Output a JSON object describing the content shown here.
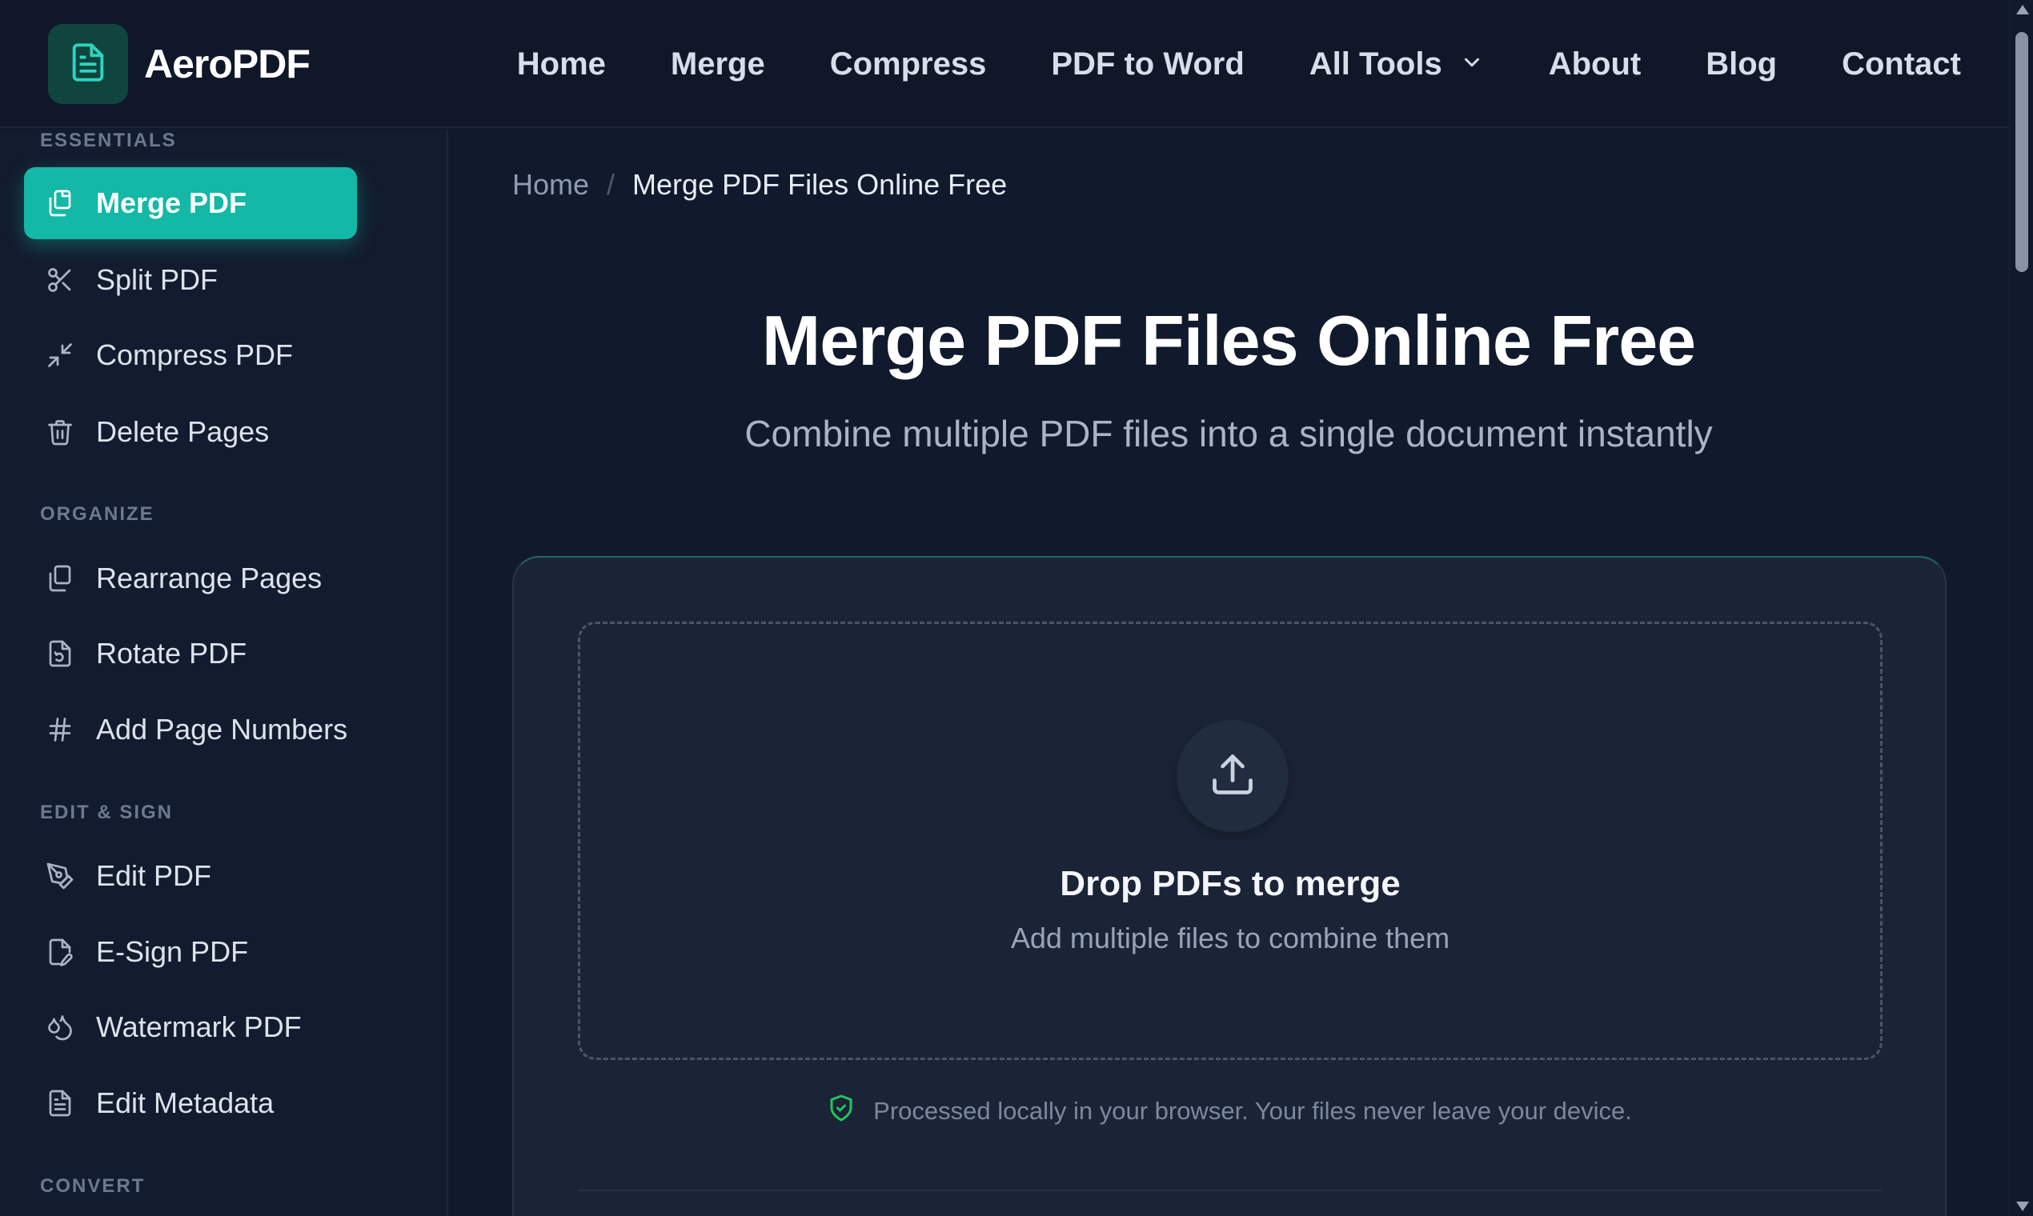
{
  "header": {
    "brand": "AeroPDF",
    "logo_icon": "document-icon",
    "nav": [
      {
        "label": "Home"
      },
      {
        "label": "Merge"
      },
      {
        "label": "Compress"
      },
      {
        "label": "PDF to Word"
      },
      {
        "label": "All Tools",
        "icon": "chevron-down-icon"
      },
      {
        "label": "About"
      },
      {
        "label": "Blog"
      },
      {
        "label": "Contact"
      }
    ]
  },
  "sidebar": {
    "sections": [
      {
        "label": "ESSENTIALS",
        "items": [
          {
            "label": "Merge PDF",
            "icon": "merge-icon",
            "active": true
          },
          {
            "label": "Split PDF",
            "icon": "scissors-icon"
          },
          {
            "label": "Compress PDF",
            "icon": "compress-icon"
          },
          {
            "label": "Delete Pages",
            "icon": "trash-icon"
          }
        ]
      },
      {
        "label": "ORGANIZE",
        "items": [
          {
            "label": "Rearrange Pages",
            "icon": "copy-icon"
          },
          {
            "label": "Rotate PDF",
            "icon": "rotate-file-icon"
          },
          {
            "label": "Add Page Numbers",
            "icon": "hash-icon"
          }
        ]
      },
      {
        "label": "EDIT & SIGN",
        "items": [
          {
            "label": "Edit PDF",
            "icon": "pen-tool-icon"
          },
          {
            "label": "E-Sign PDF",
            "icon": "file-signature-icon"
          },
          {
            "label": "Watermark PDF",
            "icon": "droplets-icon"
          },
          {
            "label": "Edit Metadata",
            "icon": "file-text-icon"
          }
        ]
      },
      {
        "label": "CONVERT",
        "items": []
      }
    ]
  },
  "breadcrumb": {
    "home": "Home",
    "separator": "/",
    "current": "Merge PDF Files Online Free"
  },
  "main": {
    "title": "Merge PDF Files Online Free",
    "subtitle": "Combine multiple PDF files into a single document instantly"
  },
  "dropzone": {
    "icon": "upload-icon",
    "title": "Drop PDFs to merge",
    "subtitle": "Add multiple files to combine them"
  },
  "privacy": {
    "icon": "shield-check-icon",
    "text": "Processed locally in your browser. Your files never leave your device."
  },
  "colors": {
    "accent": "#14b8a6",
    "background": "#111a2c",
    "header": "#0f1729",
    "card": "#1b2436",
    "shield": "#22c55e"
  }
}
